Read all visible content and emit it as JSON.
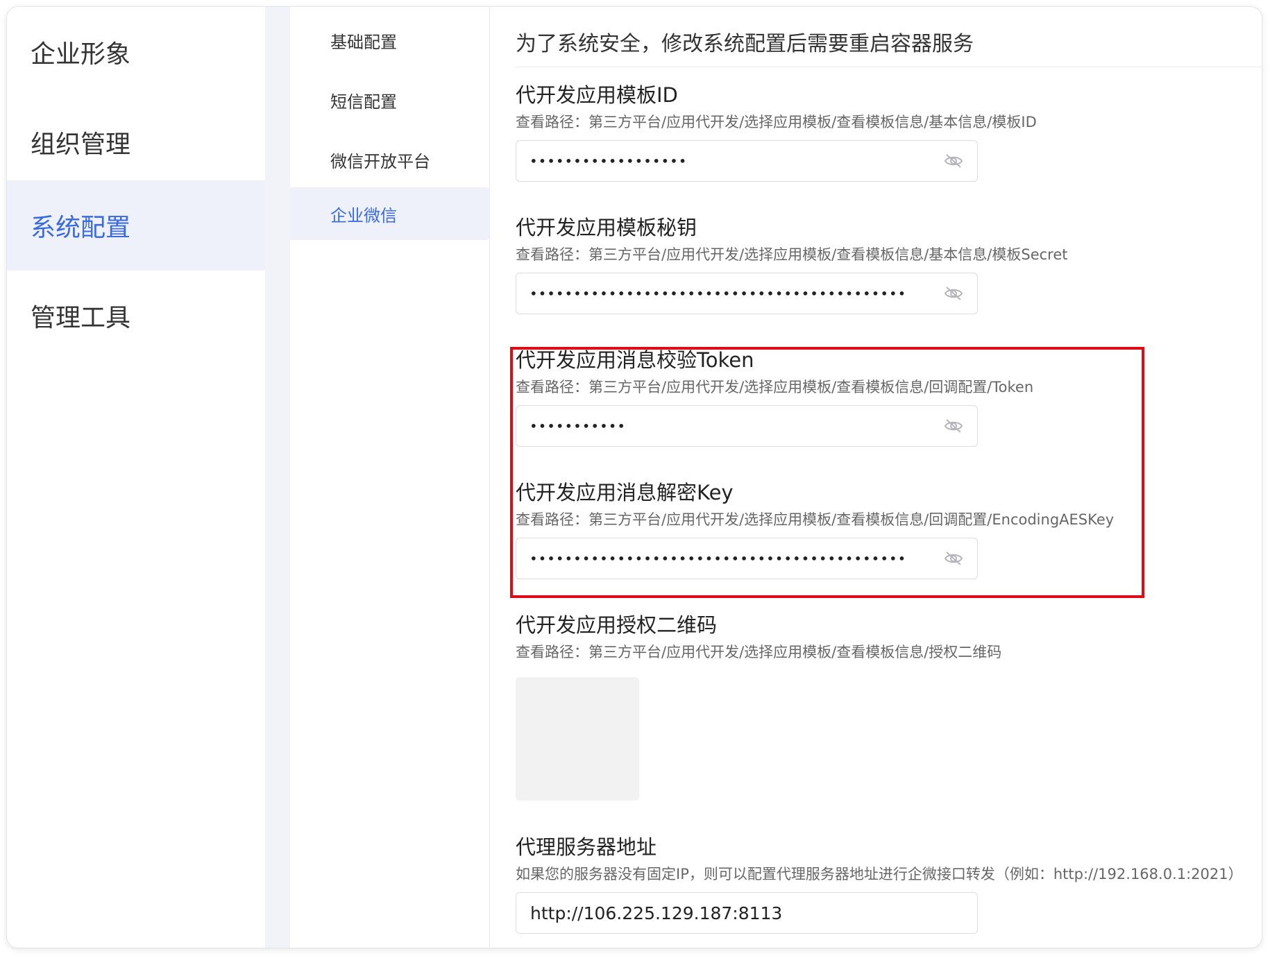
{
  "primary_nav": {
    "items": [
      {
        "label": "企业形象"
      },
      {
        "label": "组织管理"
      },
      {
        "label": "系统配置"
      },
      {
        "label": "管理工具"
      }
    ]
  },
  "secondary_nav": {
    "items": [
      {
        "label": "基础配置"
      },
      {
        "label": "短信配置"
      },
      {
        "label": "微信开放平台"
      },
      {
        "label": "企业微信"
      }
    ]
  },
  "main": {
    "notice": "为了系统安全，修改系统配置后需要重启容器服务",
    "fields": [
      {
        "title": "代开发应用模板ID",
        "path": "查看路径：第三方平台/应用代开发/选择应用模板/查看模板信息/基本信息/模板ID",
        "masked_value": "••••••••••••••••••"
      },
      {
        "title": "代开发应用模板秘钥",
        "path": "查看路径：第三方平台/应用代开发/选择应用模板/查看模板信息/基本信息/模板Secret",
        "masked_value": "•••••••••••••••••••••••••••••••••••••••••••"
      },
      {
        "title": "代开发应用消息校验Token",
        "path": "查看路径：第三方平台/应用代开发/选择应用模板/查看模板信息/回调配置/Token",
        "masked_value": "•••••••••••"
      },
      {
        "title": "代开发应用消息解密Key",
        "path": "查看路径：第三方平台/应用代开发/选择应用模板/查看模板信息/回调配置/EncodingAESKey",
        "masked_value": "•••••••••••••••••••••••••••••••••••••••••••"
      }
    ],
    "qr_field": {
      "title": "代开发应用授权二维码",
      "path": "查看路径：第三方平台/应用代开发/选择应用模板/查看模板信息/授权二维码"
    },
    "proxy_field": {
      "title": "代理服务器地址",
      "description": "如果您的服务器没有固定IP，则可以配置代理服务器地址进行企微接口转发（例如：http://192.168.0.1:2021）",
      "value": "http://106.225.129.187:8113"
    }
  },
  "icons": {
    "visibility_toggle": "eye-off-icon"
  },
  "colors": {
    "accent": "#3a6ae0",
    "active_bg": "#eef1fa",
    "highlight": "#e00c15"
  }
}
